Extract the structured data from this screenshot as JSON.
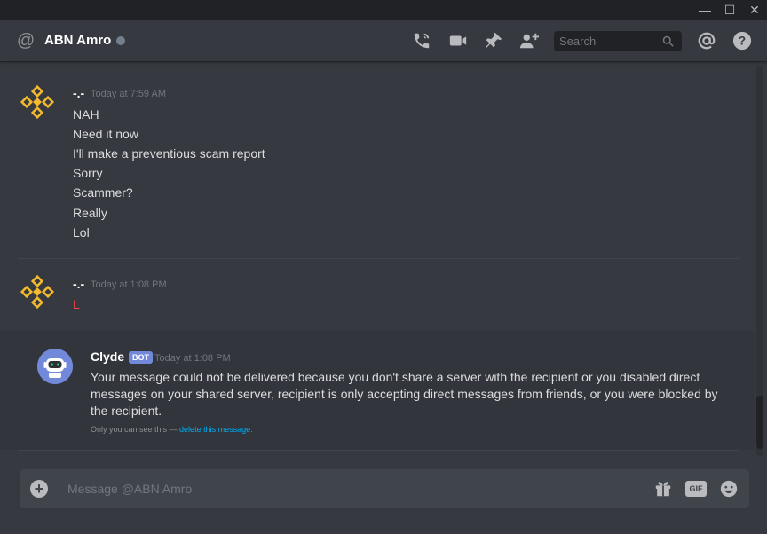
{
  "window": {
    "minimize_glyph": "—",
    "maximize_glyph": "☐",
    "close_glyph": "✕"
  },
  "header": {
    "at_glyph": "@",
    "channel_name": "ABN Amro",
    "search_placeholder": "Search",
    "mentions_glyph": "@",
    "help_glyph": "?"
  },
  "messages": [
    {
      "author": "-.-",
      "timestamp": "Today at 7:59 AM",
      "lines": [
        "NAH",
        "Need it now",
        "I'll make a preventious scam report",
        "Sorry",
        "Scammer?",
        "Really",
        "Lol"
      ]
    },
    {
      "author": "-.-",
      "timestamp": "Today at 1:08 PM",
      "lines": [
        "L"
      ],
      "line_color": "#f04747"
    }
  ],
  "clyde": {
    "name": "Clyde",
    "tag": "BOT",
    "timestamp": "Today at 1:08 PM",
    "text": "Your message could not be delivered because you don't share a server with the recipient or you disabled direct messages on your shared server, recipient is only accepting direct messages from friends, or you were blocked by the recipient.",
    "ephemeral_prefix": "Only you can see this — ",
    "ephemeral_link": "delete this message."
  },
  "composer": {
    "upload_glyph": "+",
    "placeholder": "Message @ABN Amro",
    "gif_label": "GIF"
  },
  "colors": {
    "background": "#36393f",
    "titlebar": "#202225",
    "binance_yellow": "#f3ba2f",
    "blurple": "#7289da",
    "link": "#00b0f4",
    "red_text": "#f04747"
  },
  "icons": [
    "at-icon",
    "phone-call-icon",
    "video-call-icon",
    "pin-icon",
    "add-friend-icon",
    "search-icon",
    "mentions-icon",
    "help-icon",
    "binance-logo-icon",
    "clyde-robot-icon",
    "add-upload-icon",
    "gift-icon",
    "gif-icon",
    "emoji-icon"
  ]
}
